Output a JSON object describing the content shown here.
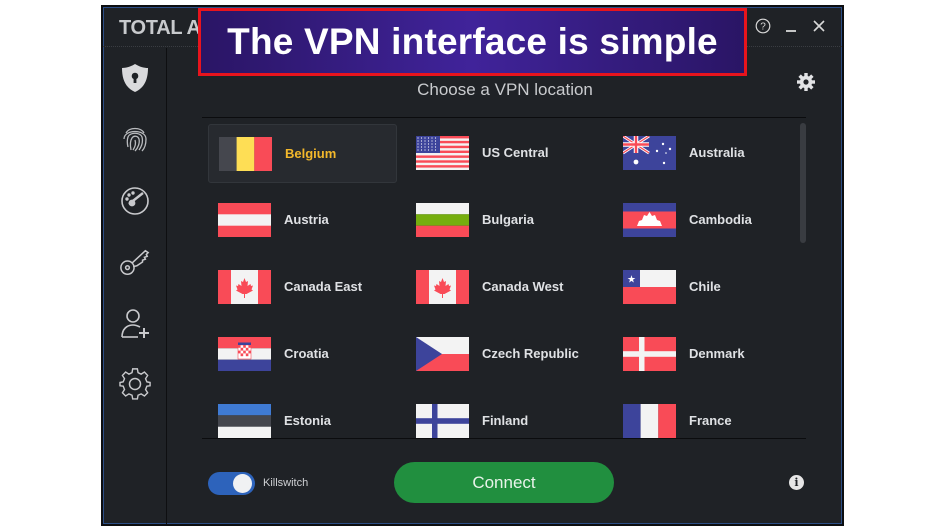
{
  "app": {
    "brand": "TOTAL A"
  },
  "titlebar": {
    "help_icon": "question-circle-icon",
    "minimize_icon": "minimize-icon",
    "close_icon": "close-icon"
  },
  "banner": {
    "text": "The VPN interface is simple"
  },
  "sidebar": {
    "items": [
      {
        "name": "vpn-shield",
        "icon": "shield-keyhole-icon"
      },
      {
        "name": "fingerprint",
        "icon": "fingerprint-icon"
      },
      {
        "name": "speedometer",
        "icon": "speedometer-icon"
      },
      {
        "name": "password-key",
        "icon": "key-icon"
      },
      {
        "name": "add-user",
        "icon": "user-plus-icon"
      },
      {
        "name": "settings",
        "icon": "gear-icon"
      }
    ]
  },
  "main": {
    "heading": "Choose a VPN location",
    "settings_icon": "gear-icon",
    "locations": [
      {
        "name": "Belgium",
        "flag": "belgium",
        "selected": true
      },
      {
        "name": "US Central",
        "flag": "usa",
        "selected": false
      },
      {
        "name": "Australia",
        "flag": "australia",
        "selected": false
      },
      {
        "name": "Austria",
        "flag": "austria",
        "selected": false
      },
      {
        "name": "Bulgaria",
        "flag": "bulgaria",
        "selected": false
      },
      {
        "name": "Cambodia",
        "flag": "cambodia",
        "selected": false
      },
      {
        "name": "Canada East",
        "flag": "canada",
        "selected": false
      },
      {
        "name": "Canada West",
        "flag": "canada",
        "selected": false
      },
      {
        "name": "Chile",
        "flag": "chile",
        "selected": false
      },
      {
        "name": "Croatia",
        "flag": "croatia",
        "selected": false
      },
      {
        "name": "Czech Republic",
        "flag": "czech",
        "selected": false
      },
      {
        "name": "Denmark",
        "flag": "denmark",
        "selected": false
      },
      {
        "name": "Estonia",
        "flag": "estonia",
        "selected": false
      },
      {
        "name": "Finland",
        "flag": "finland",
        "selected": false
      },
      {
        "name": "France",
        "flag": "france",
        "selected": false
      }
    ]
  },
  "footer": {
    "killswitch_label": "Killswitch",
    "killswitch_on": true,
    "connect_label": "Connect",
    "info_icon": "info-icon",
    "info_glyph": "i"
  },
  "colors": {
    "selected_text": "#f3b82b",
    "connect_green": "#218f3f",
    "toggle_blue": "#2d63bb",
    "banner_border": "#e8141d"
  }
}
